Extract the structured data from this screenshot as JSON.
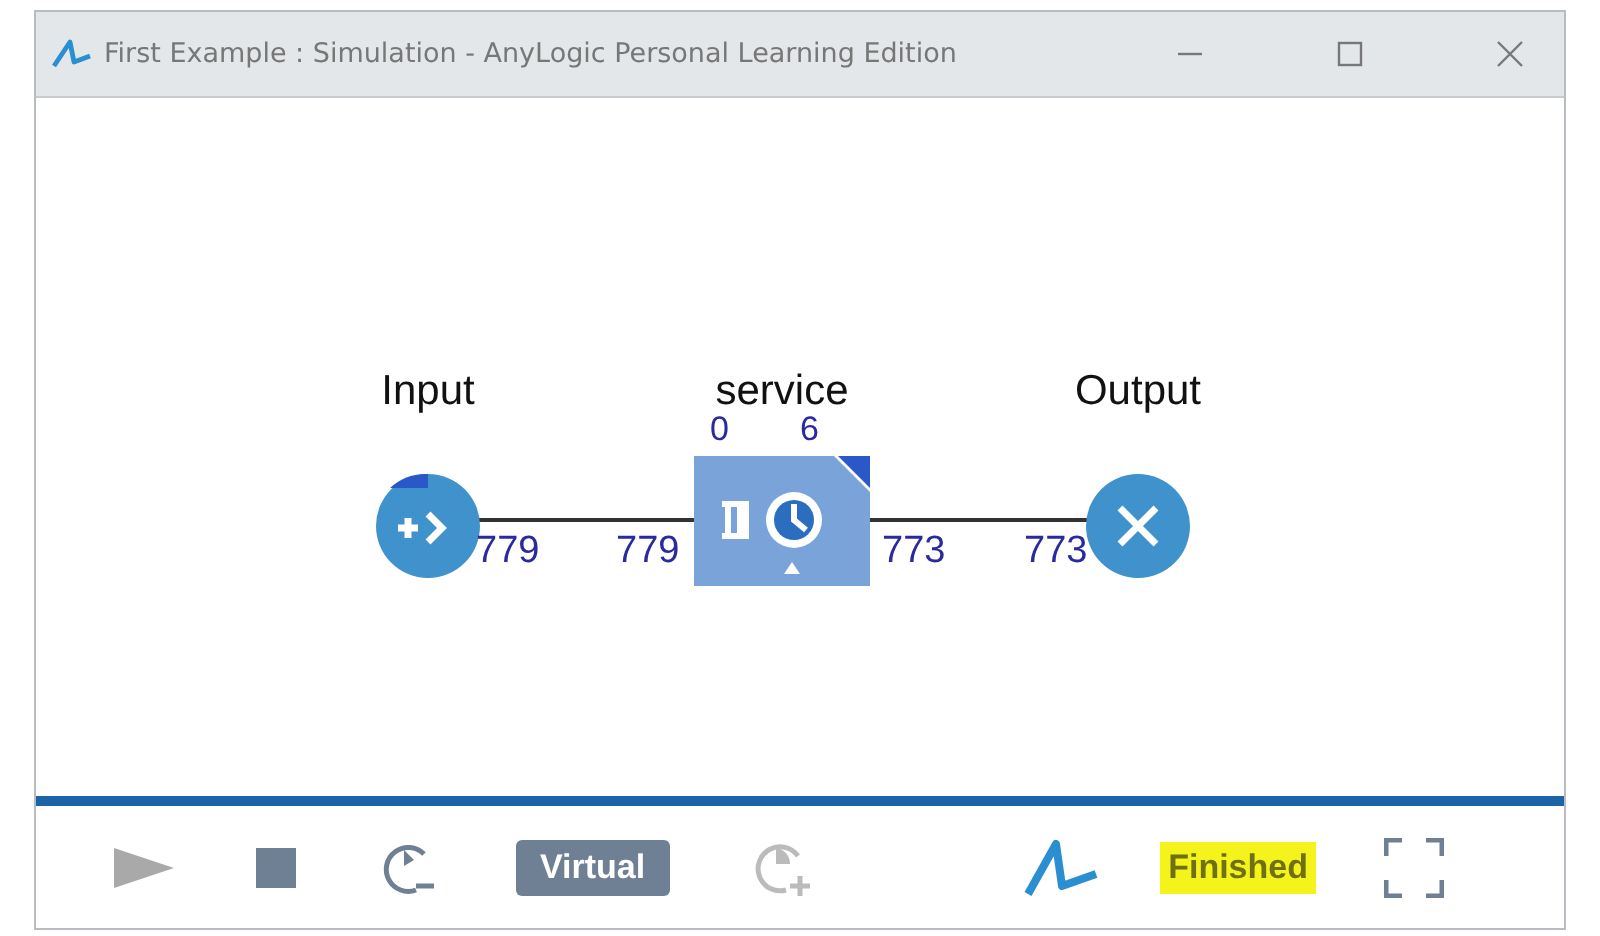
{
  "window": {
    "title": "First Example : Simulation - AnyLogic Personal Learning Edition"
  },
  "diagram": {
    "blocks": [
      {
        "kind": "source",
        "label": "Input",
        "out_count": "779"
      },
      {
        "kind": "delay",
        "label": "service",
        "in_count": "779",
        "out_count": "773",
        "queue_count": "0",
        "busy_count": "6"
      },
      {
        "kind": "sink",
        "label": "Output",
        "in_count": "773"
      }
    ]
  },
  "toolbar": {
    "speed_mode": "Virtual",
    "status": "Finished"
  }
}
